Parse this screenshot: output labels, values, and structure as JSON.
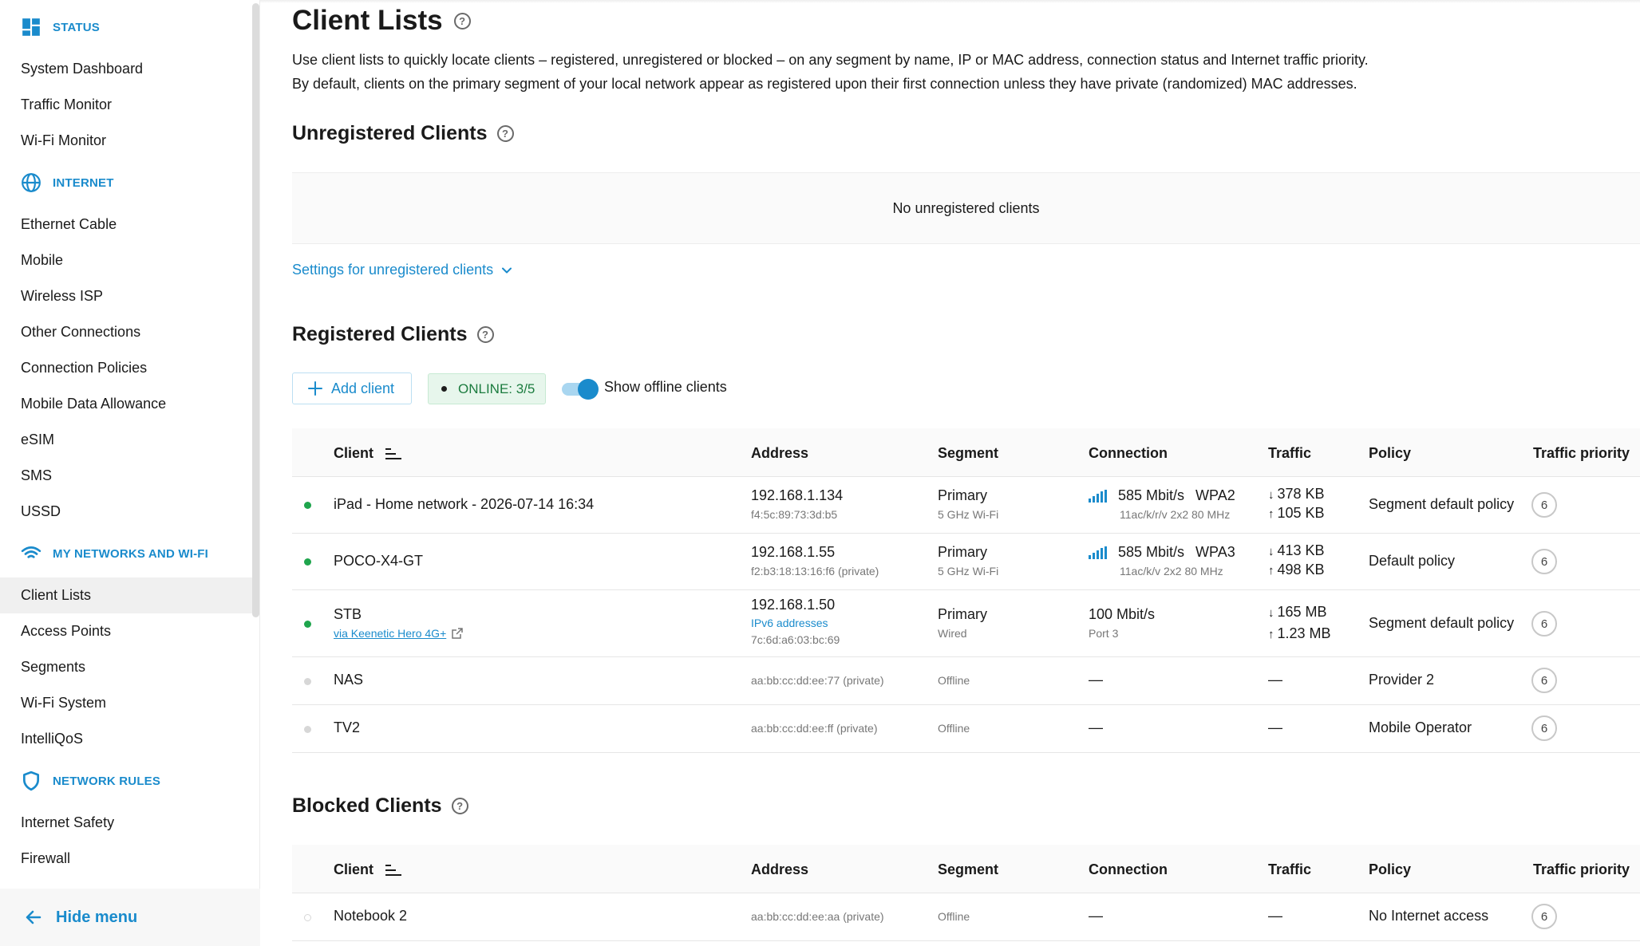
{
  "sidebar": {
    "sections": [
      {
        "title": "STATUS",
        "icon": "dashboard-icon"
      },
      {
        "title": "INTERNET",
        "icon": "globe-icon"
      },
      {
        "title": "MY NETWORKS AND WI-FI",
        "icon": "wifi-icon"
      },
      {
        "title": "NETWORK RULES",
        "icon": "shield-icon"
      }
    ],
    "items": [
      "System Dashboard",
      "Traffic Monitor",
      "Wi-Fi Monitor",
      "Ethernet Cable",
      "Mobile",
      "Wireless ISP",
      "Other Connections",
      "Connection Policies",
      "Mobile Data Allowance",
      "eSIM",
      "SMS",
      "USSD",
      "Client Lists",
      "Access Points",
      "Segments",
      "Wi-Fi System",
      "IntelliQoS",
      "Internet Safety",
      "Firewall"
    ],
    "active_item": "Client Lists",
    "hide_menu": "Hide menu"
  },
  "page": {
    "title": "Client Lists",
    "desc1": "Use client lists to quickly locate clients – registered, unregistered or blocked – on any segment by name, IP or MAC address, connection status and Internet traffic priority.",
    "desc2": "By default, clients on the primary segment of your local network appear as registered upon their first connection unless they have private (randomized) MAC addresses."
  },
  "unregistered": {
    "title": "Unregistered Clients",
    "empty": "No unregistered clients",
    "settings_link": "Settings for unregistered clients"
  },
  "registered": {
    "title": "Registered Clients",
    "add_client": "Add client",
    "online_badge": "ONLINE: 3/5",
    "show_offline": "Show offline clients",
    "show_offline_on": true
  },
  "columns": [
    "Client",
    "Address",
    "Segment",
    "Connection",
    "Traffic",
    "Policy",
    "Traffic priority"
  ],
  "registered_rows": [
    {
      "status": "online",
      "name": "iPad - Home network - 2026-07-14 16:34",
      "ip": "192.168.1.134",
      "mac": "f4:5c:89:73:3d:b5",
      "segment": "Primary",
      "segment_sub": "5 GHz Wi-Fi",
      "conn_speed": "585 Mbit/s",
      "conn_sec": "WPA2",
      "conn_sub": "11ac/k/r/v 2x2 80 MHz",
      "down": "378 KB",
      "up": "105 KB",
      "policy": "Segment default policy",
      "priority": "6"
    },
    {
      "status": "online",
      "name": "POCO-X4-GT",
      "ip": "192.168.1.55",
      "mac": "f2:b3:18:13:16:f6 (private)",
      "segment": "Primary",
      "segment_sub": "5 GHz Wi-Fi",
      "conn_speed": "585 Mbit/s",
      "conn_sec": "WPA3",
      "conn_sub": "11ac/k/v 2x2 80 MHz",
      "down": "413 KB",
      "up": "498 KB",
      "policy": "Default policy",
      "priority": "6"
    },
    {
      "status": "online",
      "name": "STB",
      "via": "via Keenetic Hero 4G+",
      "ip": "192.168.1.50",
      "ipv6": "IPv6 addresses",
      "mac": "7c:6d:a6:03:bc:69",
      "segment": "Primary",
      "segment_sub": "Wired",
      "conn_speed": "100 Mbit/s",
      "conn_sub": "Port 3",
      "down": "165 MB",
      "up": "1.23 MB",
      "policy": "Segment default policy",
      "priority": "6"
    },
    {
      "status": "offline",
      "name": "NAS",
      "mac": "aa:bb:cc:dd:ee:77 (private)",
      "segment_sub": "Offline",
      "connection": "—",
      "traffic": "—",
      "policy": "Provider 2",
      "priority": "6"
    },
    {
      "status": "offline",
      "name": "TV2",
      "mac": "aa:bb:cc:dd:ee:ff (private)",
      "segment_sub": "Offline",
      "connection": "—",
      "traffic": "—",
      "policy": "Mobile Operator",
      "priority": "6"
    }
  ],
  "blocked": {
    "title": "Blocked Clients",
    "rows": [
      {
        "status": "blocked",
        "name": "Notebook 2",
        "mac": "aa:bb:cc:dd:ee:aa (private)",
        "segment_sub": "Offline",
        "connection": "—",
        "traffic": "—",
        "policy": "No Internet access",
        "priority": "6"
      }
    ]
  },
  "colors": {
    "accent": "#1a8bcc",
    "online": "#1fa54d",
    "badge_bg": "#e7f6ec"
  }
}
